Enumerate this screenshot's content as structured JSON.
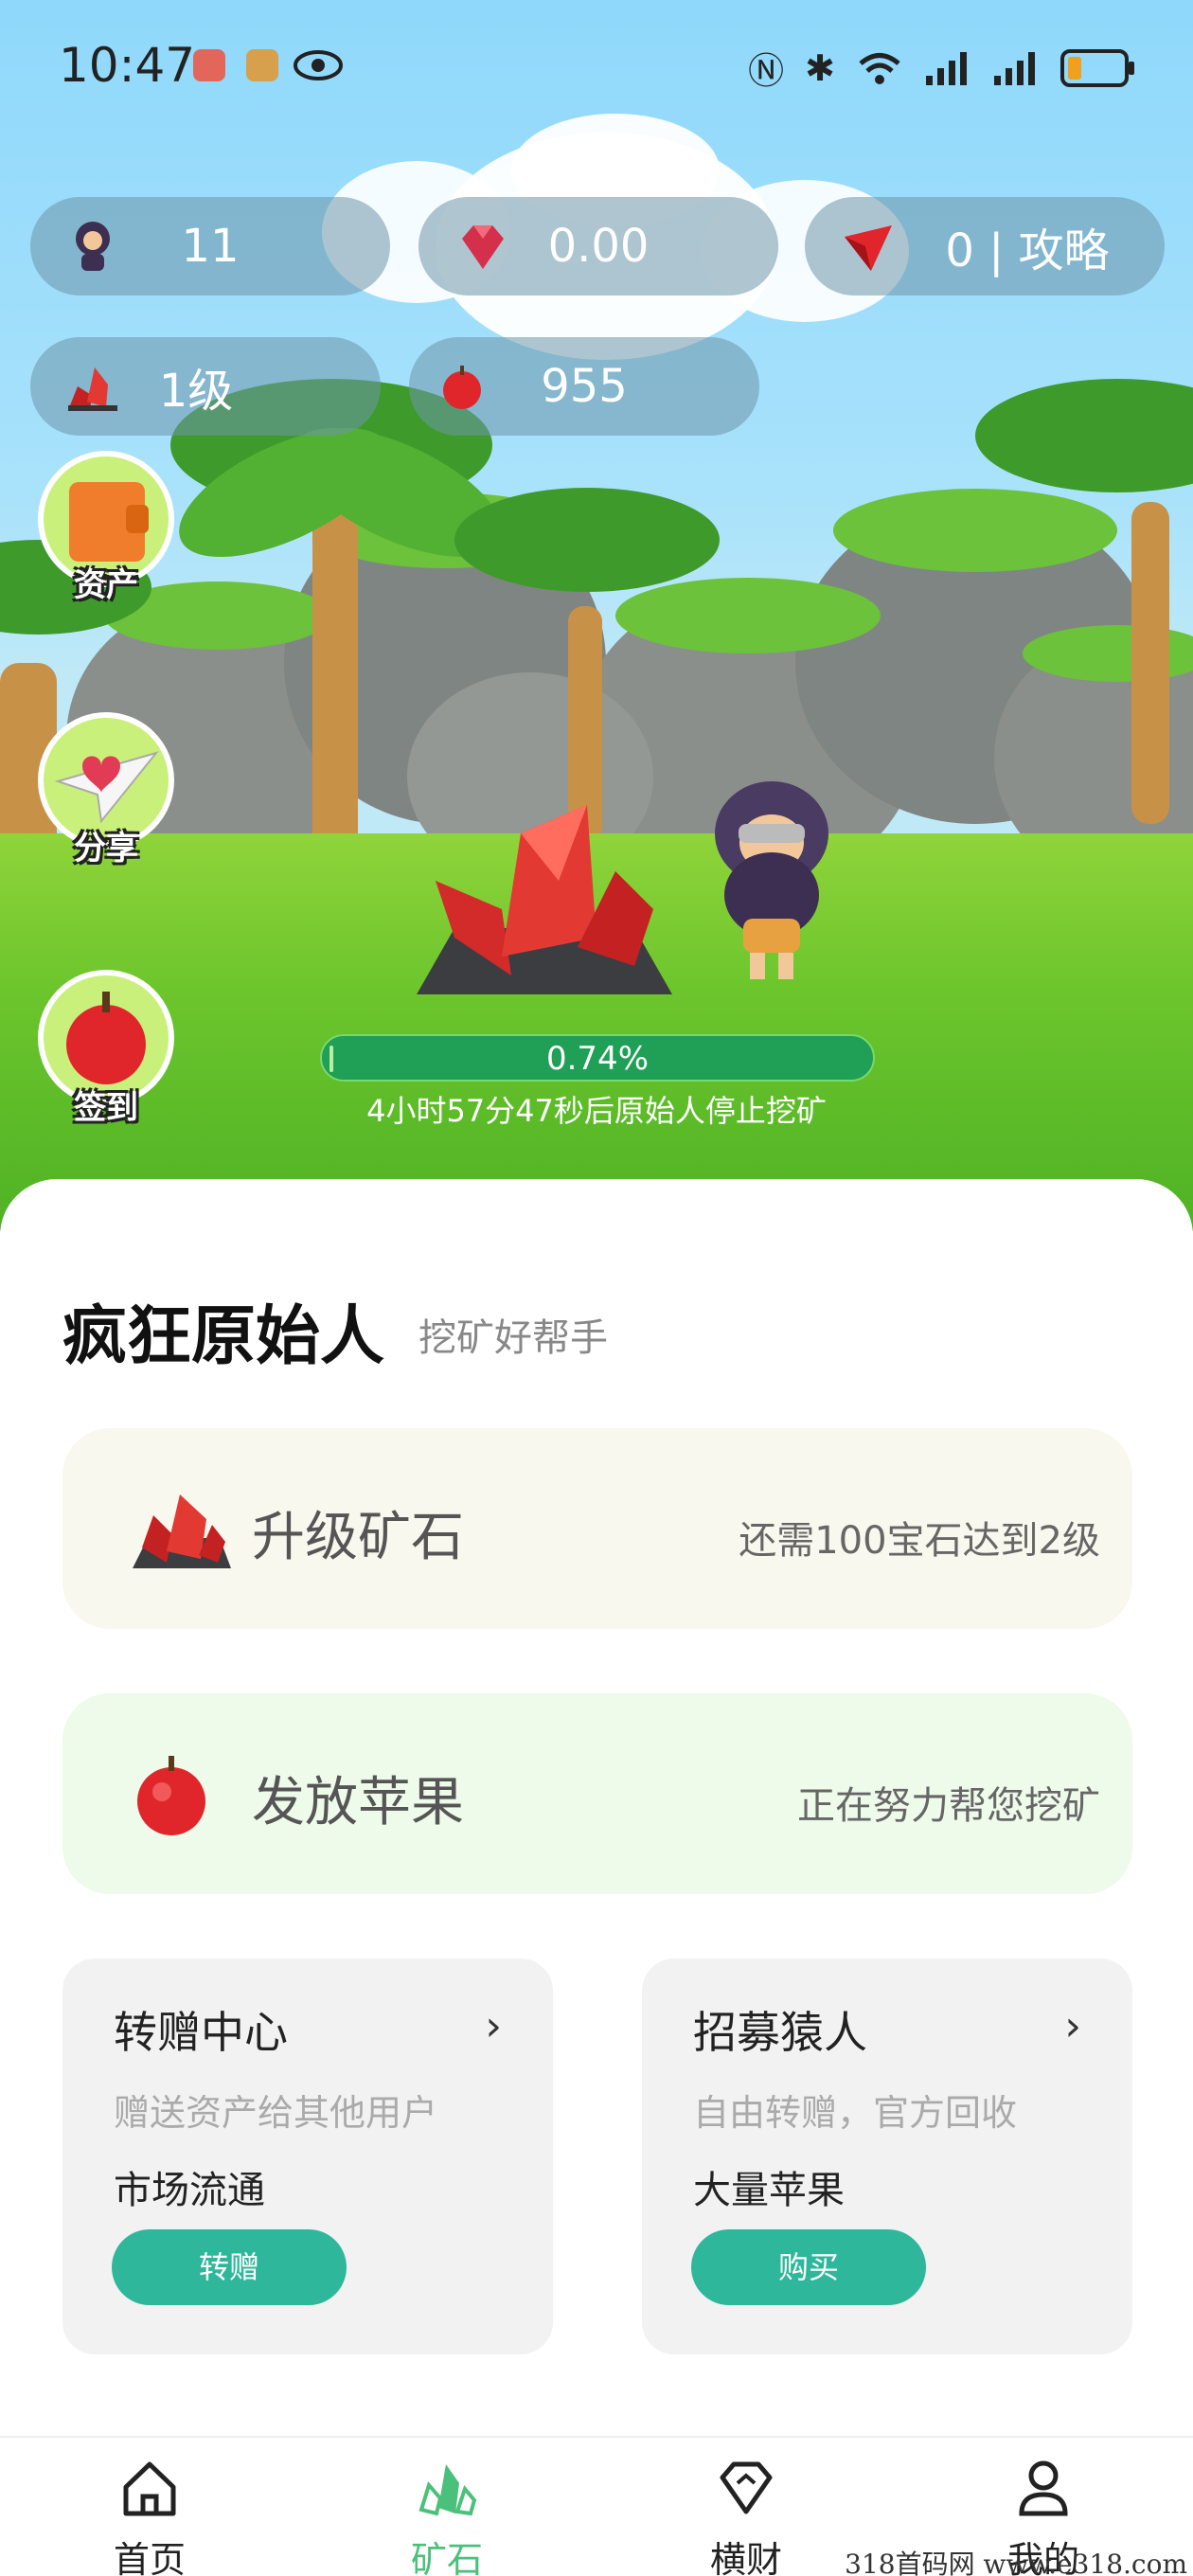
{
  "status_bar": {
    "time": "10:47"
  },
  "stats": {
    "characters": "11",
    "gems": "0.00",
    "guide": "0 | 攻略",
    "level": "1级",
    "apples": "955"
  },
  "side_buttons": {
    "assets": "资产",
    "share": "分享",
    "checkin": "签到"
  },
  "mining": {
    "progress_label": "0.74%",
    "progress_fraction": 0.0074,
    "countdown": "4小时57分47秒后原始人停止挖矿"
  },
  "header": {
    "title": "疯狂原始人",
    "subtitle": "挖矿好帮手"
  },
  "cards": {
    "upgrade": {
      "label": "升级矿石",
      "info": "还需100宝石达到2级"
    },
    "apple": {
      "label": "发放苹果",
      "info": "正在努力帮您挖矿"
    }
  },
  "transfer": {
    "title": "转赠中心",
    "desc": "赠送资产给其他用户",
    "desc2": "市场流通",
    "button": "转赠"
  },
  "recruit": {
    "title": "招募猿人",
    "desc": "自由转赠，官方回收",
    "desc2": "大量苹果",
    "button": "购买"
  },
  "nav": {
    "home": "首页",
    "ore": "矿石",
    "hengcai": "横财",
    "mine": "我的"
  },
  "watermark": "318首码网 www.e318.com",
  "colors": {
    "accent": "#2eb79a",
    "active_nav": "#4bc07b",
    "progress": "#1fa056"
  }
}
